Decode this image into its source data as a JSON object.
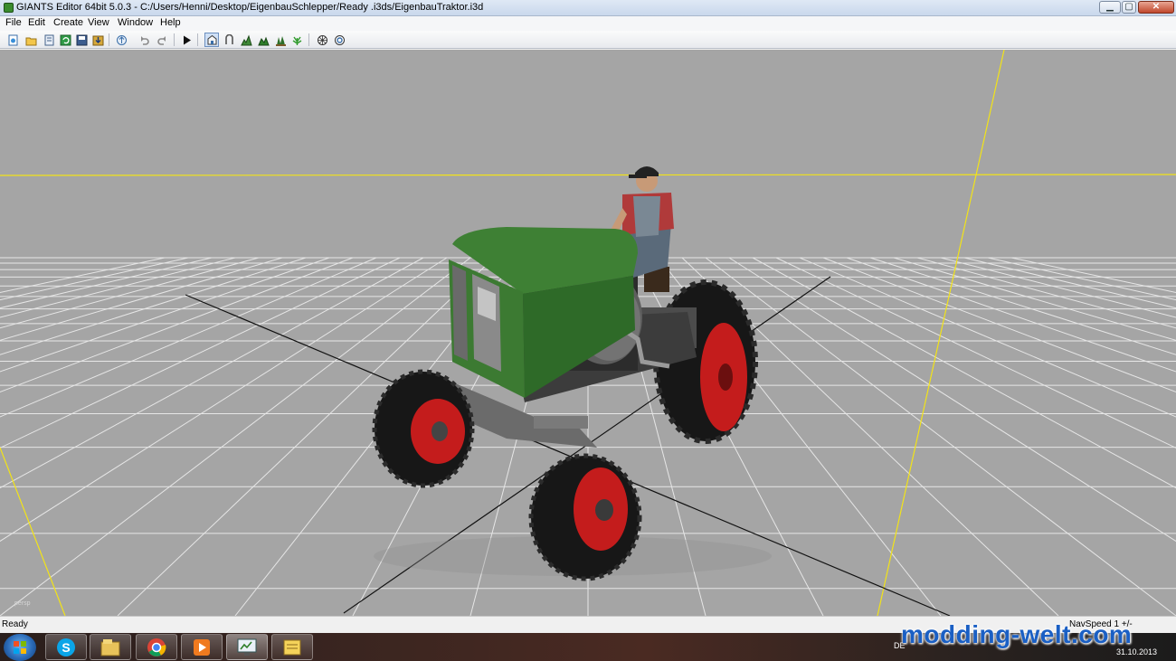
{
  "window": {
    "title": "GIANTS Editor 64bit 5.0.3 - C:/Users/Henni/Desktop/EigenbauSchlepper/Ready .i3ds/EigenbauTraktor.i3d",
    "minimize": "▁",
    "maximize": "▢",
    "close": "✕"
  },
  "menu": {
    "items": [
      {
        "label": "File"
      },
      {
        "label": "Edit"
      },
      {
        "label": "Create"
      },
      {
        "label": "View"
      },
      {
        "label": "Window"
      },
      {
        "label": "Help"
      }
    ]
  },
  "toolbar": {
    "icons": [
      "new-icon",
      "open-icon",
      "save-as-icon",
      "refresh-icon",
      "save-icon",
      "import-icon",
      "export-icon",
      "undo-icon",
      "redo-icon",
      "play-icon",
      "select-mode-icon",
      "move-mode-icon",
      "terrain-sculpt-icon",
      "terrain-paint-icon",
      "foliage-paint-icon",
      "foliage-edit-icon",
      "grid-icon",
      "snap-icon"
    ]
  },
  "viewport": {
    "camera_label": "persp",
    "background": "#a5a5a5",
    "grid_color": "#e6e6e6",
    "axis_color": "#f2e318",
    "tractor_body": "#3c7a32",
    "wheel_rim": "#c41c1c"
  },
  "status": {
    "text": "Ready",
    "right": "NavSpeed 1 +/-"
  },
  "taskbar": {
    "apps": [
      "skype-icon",
      "explorer-icon",
      "chrome-icon",
      "media-player-icon",
      "giants-editor-icon",
      "notes-icon"
    ],
    "language": "DE",
    "clock_date": "31.10.2013"
  },
  "watermark": "modding-welt.com"
}
